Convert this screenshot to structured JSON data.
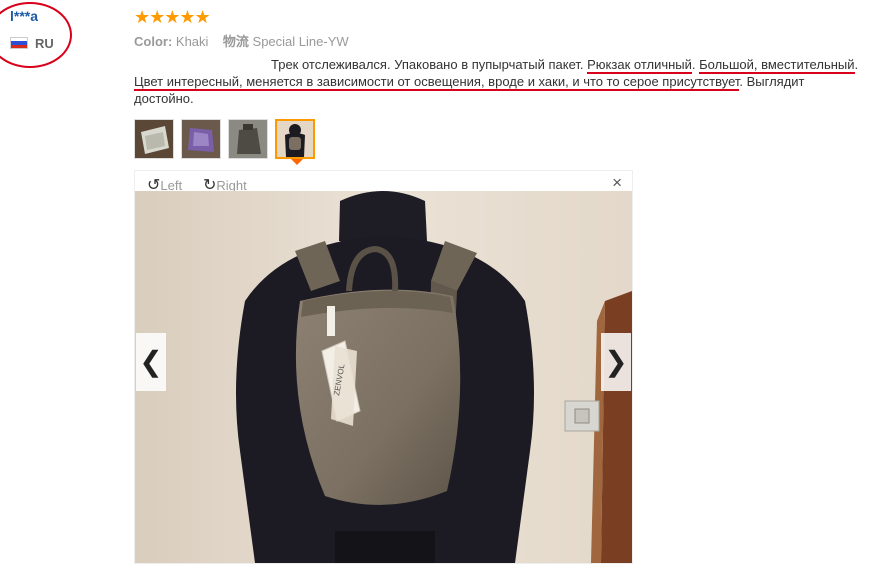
{
  "reviewer": {
    "name": "l***a",
    "country": "RU",
    "colors": {
      "flag": [
        "#ffffff",
        "#2d4fd6",
        "#d52b1e"
      ],
      "highlight_circle": "#d9001b"
    }
  },
  "review": {
    "stars": "★★★★★",
    "color_label": "Color:",
    "color_value": "Khaki",
    "shipping_label": "物流",
    "shipping_value": "Special Line-YW",
    "text_line1_a": "Трек отслеживался. Упаковано в пупырчатый пакет. ",
    "text_u1": "Рюкзак отличный",
    "text_line1_b": ". ",
    "text_u2": "Большой, вместительный",
    "text_line1_c": ".",
    "text_u3": "Цвет интересный, меняется в зависимости от освещения, вроде и хаки, и что то серое присутствует",
    "text_line2_b": ". Выглядит",
    "text_line3": "достойно."
  },
  "thumbnails": [
    {
      "name": "bubble-wrap-package"
    },
    {
      "name": "purple-package"
    },
    {
      "name": "backpack-gray"
    },
    {
      "name": "backpack-on-mannequin",
      "selected": true
    }
  ],
  "viewer": {
    "rotate_left_label": "Left",
    "rotate_right_label": "Right",
    "close_symbol": "×",
    "prev_symbol": "❮",
    "next_symbol": "❯",
    "tag_text": "ZENVOL"
  }
}
